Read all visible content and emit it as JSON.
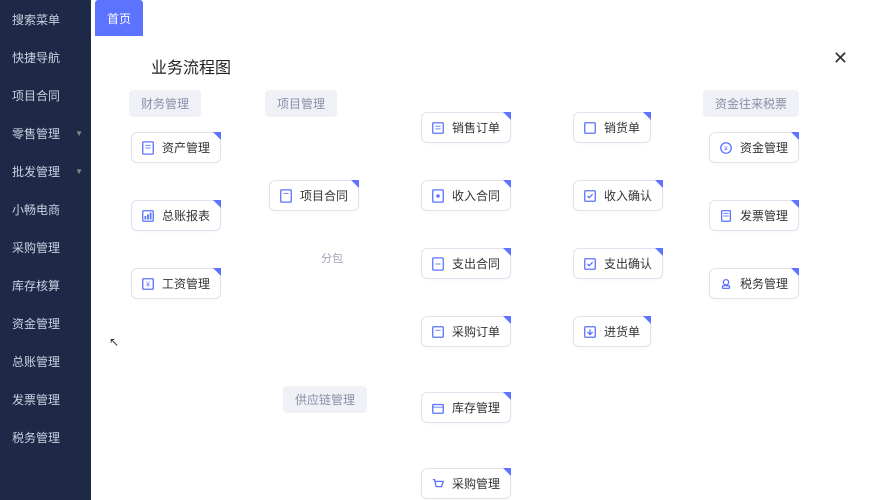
{
  "sidebar": {
    "items": [
      {
        "label": "搜索菜单",
        "expand": false
      },
      {
        "label": "快捷导航",
        "expand": false
      },
      {
        "label": "项目合同",
        "expand": false
      },
      {
        "label": "零售管理",
        "expand": true
      },
      {
        "label": "批发管理",
        "expand": true
      },
      {
        "label": "小畅电商",
        "expand": false
      },
      {
        "label": "采购管理",
        "expand": false
      },
      {
        "label": "库存核算",
        "expand": false
      },
      {
        "label": "资金管理",
        "expand": false
      },
      {
        "label": "总账管理",
        "expand": false
      },
      {
        "label": "发票管理",
        "expand": false
      },
      {
        "label": "税务管理",
        "expand": false
      }
    ]
  },
  "tab": {
    "home_label": "首页"
  },
  "diagram": {
    "title": "业务流程图",
    "groups": {
      "fin": "财务管理",
      "proj": "项目管理",
      "fund": "资金往来税票",
      "supply": "供应链管理"
    },
    "sub": {
      "fenbao": "分包"
    },
    "nodes": {
      "asset": "资产管理",
      "ledger": "总账报表",
      "salary": "工资管理",
      "contract": "项目合同",
      "sales": "销售订单",
      "income_ct": "收入合同",
      "expense_ct": "支出合同",
      "purchase": "采购订单",
      "inventory": "库存管理",
      "purchase_mgmt": "采购管理",
      "ship": "销货单",
      "income_cf": "收入确认",
      "expense_cf": "支出确认",
      "stockin": "进货单",
      "fund": "资金管理",
      "invoice": "发票管理",
      "tax": "税务管理"
    }
  }
}
